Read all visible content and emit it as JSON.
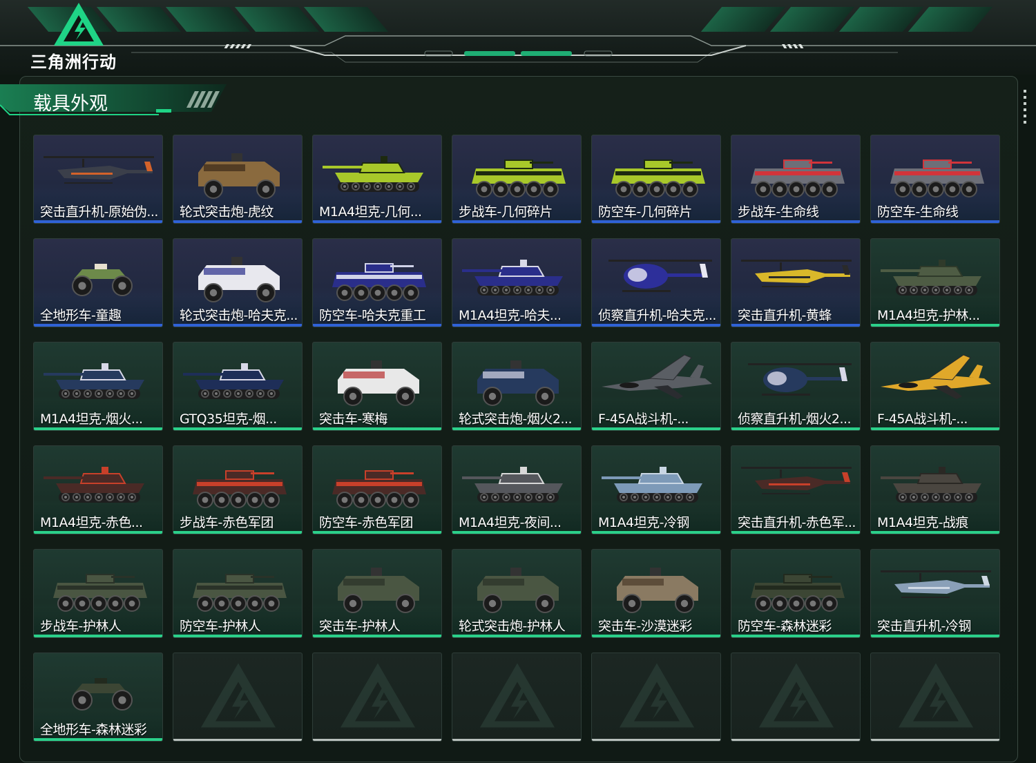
{
  "app": {
    "logo_text": "三角洲行动",
    "section_title": "载具外观"
  },
  "colors": {
    "accent_green": "#2bd08a",
    "accent_blue": "#2f62d6",
    "background": "#0e1712"
  },
  "cards": [
    {
      "label": "突击直升机-原始伪...",
      "type": "helicopter",
      "tone": "purple",
      "paint": "#3b3f4a",
      "accent": "#d4622a"
    },
    {
      "label": "轮式突击炮-虎纹",
      "type": "armored-car",
      "tone": "purple",
      "paint": "#8a6a3e",
      "accent": "#3a2a18"
    },
    {
      "label": "M1A4坦克-几何...",
      "type": "tank",
      "tone": "purple",
      "paint": "#a8c82a",
      "accent": "#1d2a10"
    },
    {
      "label": "步战车-几何碎片",
      "type": "ifv",
      "tone": "purple",
      "paint": "#a8c82a",
      "accent": "#1d2a10"
    },
    {
      "label": "防空车-几何碎片",
      "type": "ifv",
      "tone": "purple",
      "paint": "#a8c82a",
      "accent": "#1d2a10"
    },
    {
      "label": "步战车-生命线",
      "type": "ifv",
      "tone": "purple",
      "paint": "#6d6f78",
      "accent": "#d2343a"
    },
    {
      "label": "防空车-生命线",
      "type": "ifv",
      "tone": "purple",
      "paint": "#6d6f78",
      "accent": "#d2343a"
    },
    {
      "label": "全地形车-童趣",
      "type": "atv",
      "tone": "purple",
      "paint": "#6d8a4a",
      "accent": "#e7e0cf"
    },
    {
      "label": "轮式突击炮-哈夫克...",
      "type": "armored-car",
      "tone": "purple",
      "paint": "#e8e8ee",
      "accent": "#2a2e8a"
    },
    {
      "label": "防空车-哈夫克重工",
      "type": "ifv",
      "tone": "purple",
      "paint": "#2a2e8a",
      "accent": "#d0d3e8"
    },
    {
      "label": "M1A4坦克-哈夫...",
      "type": "tank",
      "tone": "purple",
      "paint": "#2a2e8a",
      "accent": "#d8d8e8"
    },
    {
      "label": "侦察直升机-哈夫克...",
      "type": "scout-heli",
      "tone": "purple",
      "paint": "#2d2f9a",
      "accent": "#e8e8f2"
    },
    {
      "label": "突击直升机-黄蜂",
      "type": "helicopter",
      "tone": "purple",
      "paint": "#d9b82a",
      "accent": "#2a2a2a"
    },
    {
      "label": "M1A4坦克-护林...",
      "type": "tank",
      "tone": "green",
      "paint": "#4e5c44",
      "accent": "#2f3a2a"
    },
    {
      "label": "M1A4坦克-烟火...",
      "type": "tank",
      "tone": "green",
      "paint": "#263a5e",
      "accent": "#d8d8e8"
    },
    {
      "label": "GTQ35坦克-烟...",
      "type": "tank",
      "tone": "green",
      "paint": "#1e2e58",
      "accent": "#d8d8e8"
    },
    {
      "label": "突击车-寒梅",
      "type": "armored-car",
      "tone": "green",
      "paint": "#e8e8e8",
      "accent": "#b83030"
    },
    {
      "label": "轮式突击炮-烟火2...",
      "type": "armored-car",
      "tone": "green",
      "paint": "#263a5e",
      "accent": "#d8d8e8"
    },
    {
      "label": "F-45A战斗机-...",
      "type": "jet",
      "tone": "green",
      "paint": "#5a5e64",
      "accent": "#2a2c30"
    },
    {
      "label": "侦察直升机-烟火2...",
      "type": "scout-heli",
      "tone": "green",
      "paint": "#263a5e",
      "accent": "#d8d8e8"
    },
    {
      "label": "F-45A战斗机-...",
      "type": "jet",
      "tone": "green",
      "paint": "#e0a82a",
      "accent": "#2a2a2a"
    },
    {
      "label": "M1A4坦克-赤色...",
      "type": "tank",
      "tone": "green",
      "paint": "#4a2a26",
      "accent": "#c8402a"
    },
    {
      "label": "步战车-赤色军团",
      "type": "ifv",
      "tone": "green",
      "paint": "#4a2a26",
      "accent": "#c8402a"
    },
    {
      "label": "防空车-赤色军团",
      "type": "ifv",
      "tone": "green",
      "paint": "#4a2a26",
      "accent": "#c8402a"
    },
    {
      "label": "M1A4坦克-夜间...",
      "type": "tank",
      "tone": "green",
      "paint": "#55575c",
      "accent": "#d8d8d8"
    },
    {
      "label": "M1A4坦克-冷钢",
      "type": "tank",
      "tone": "green",
      "paint": "#7d9ab8",
      "accent": "#c9d6e4"
    },
    {
      "label": "突击直升机-赤色军...",
      "type": "helicopter",
      "tone": "green",
      "paint": "#4a2a26",
      "accent": "#c8402a"
    },
    {
      "label": "M1A4坦克-战痕",
      "type": "tank",
      "tone": "green",
      "paint": "#4a4640",
      "accent": "#2a2824"
    },
    {
      "label": "步战车-护林人",
      "type": "ifv",
      "tone": "green",
      "paint": "#4a5642",
      "accent": "#2a3228"
    },
    {
      "label": "防空车-护林人",
      "type": "ifv",
      "tone": "green",
      "paint": "#4a5642",
      "accent": "#2a3228"
    },
    {
      "label": "突击车-护林人",
      "type": "armored-car",
      "tone": "green",
      "paint": "#4a5642",
      "accent": "#2a3228"
    },
    {
      "label": "轮式突击炮-护林人",
      "type": "armored-car",
      "tone": "green",
      "paint": "#4a5642",
      "accent": "#2a3228"
    },
    {
      "label": "突击车-沙漠迷彩",
      "type": "armored-car",
      "tone": "green",
      "paint": "#8a7a62",
      "accent": "#4a3a2a"
    },
    {
      "label": "防空车-森林迷彩",
      "type": "ifv",
      "tone": "green",
      "paint": "#3c4634",
      "accent": "#222a1e"
    },
    {
      "label": "突击直升机-冷钢",
      "type": "helicopter",
      "tone": "green",
      "paint": "#8aa0b8",
      "accent": "#cfd9e4"
    },
    {
      "label": "全地形车-森林迷彩",
      "type": "atv",
      "tone": "green",
      "paint": "#3c4634",
      "accent": "#222a1e"
    },
    {
      "label": "",
      "type": "empty",
      "tone": "empty"
    },
    {
      "label": "",
      "type": "empty",
      "tone": "empty"
    },
    {
      "label": "",
      "type": "empty",
      "tone": "empty"
    },
    {
      "label": "",
      "type": "empty",
      "tone": "empty"
    },
    {
      "label": "",
      "type": "empty",
      "tone": "empty"
    },
    {
      "label": "",
      "type": "empty",
      "tone": "empty"
    }
  ]
}
